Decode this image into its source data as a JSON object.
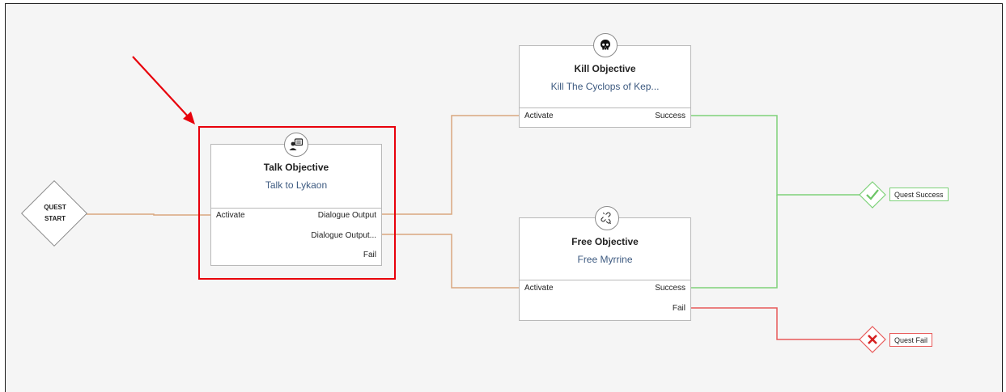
{
  "start": {
    "label_line1": "QUEST",
    "label_line2": "START"
  },
  "nodes": {
    "talk": {
      "title": "Talk Objective",
      "subtitle": "Talk to Lykaon",
      "in_port": "Activate",
      "out_ports": [
        "Dialogue Output",
        "Dialogue Output...",
        "Fail"
      ],
      "icon": "person-speech-icon"
    },
    "kill": {
      "title": "Kill Objective",
      "subtitle": "Kill The Cyclops of Kep...",
      "in_port": "Activate",
      "out_ports": [
        "Success"
      ],
      "icon": "skull-icon"
    },
    "free": {
      "title": "Free Objective",
      "subtitle": "Free Myrrine",
      "in_port": "Activate",
      "out_ports": [
        "Success",
        "Fail"
      ],
      "icon": "broken-chain-icon"
    }
  },
  "ends": {
    "success": {
      "label": "Quest Success",
      "icon": "check-icon"
    },
    "fail": {
      "label": "Quest Fail",
      "icon": "x-icon"
    }
  },
  "colors": {
    "wire_default": "#d9a77e",
    "wire_success": "#7ed27a",
    "wire_fail": "#e85a5a",
    "highlight": "#e8000b",
    "annotation_arrow": "#e8000b"
  }
}
